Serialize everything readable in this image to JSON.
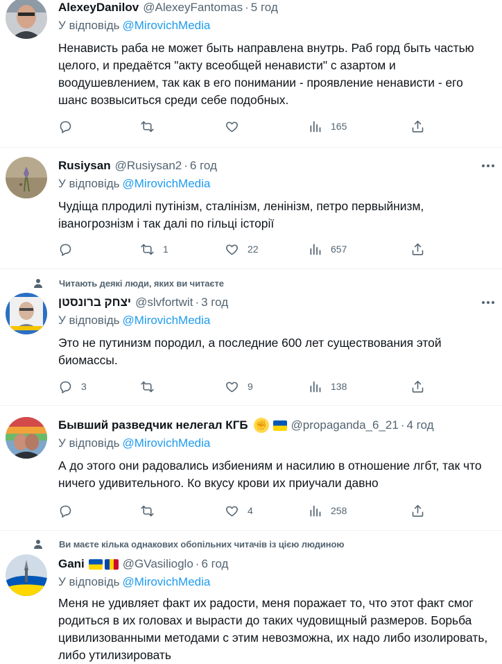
{
  "tweets": [
    {
      "name": "AlexeyDanilov",
      "handle": "@AlexeyFantomas",
      "dot": "·",
      "time": "5 год",
      "reply_prefix": "У відповідь",
      "reply_to": "@MirovichMedia",
      "text": "Ненависть раба не может быть направлена внутрь. Раб горд быть частью целого, и предаётся \"акту всеобщей ненависти\" с азартом и воодушевлением, так как в его понимании - проявление ненависти - его шанс возвыситься среди себе подобных.",
      "replies": "",
      "retweets": "",
      "likes": "",
      "views": "165"
    },
    {
      "name": "Rusiysan",
      "handle": "@Rusiysan2",
      "dot": "·",
      "time": "6 год",
      "reply_prefix": "У відповідь",
      "reply_to": "@MirovichMedia",
      "text": "Чудіща плродилі путінізм, сталінізм, ленінізм, петро первыйнизм, іваногрознізм і так далі по гільці історії",
      "replies": "",
      "retweets": "1",
      "likes": "22",
      "views": "657"
    },
    {
      "social_context": "Читають деякі люди, яких ви читаєте",
      "name": "יצחק ברונסטן",
      "handle": "@slvfortwit",
      "dot": "·",
      "time": "3 год",
      "reply_prefix": "У відповідь",
      "reply_to": "@MirovichMedia",
      "text": "Это не путинизм породил, а последние 600 лет существования этой биомассы.",
      "replies": "3",
      "retweets": "",
      "likes": "9",
      "views": "138"
    },
    {
      "name": "Бывший разведчик нелегал КГБ",
      "handle": "@propaganda_6_21",
      "dot": "·",
      "time": "4 год",
      "reply_prefix": "У відповідь",
      "reply_to": "@MirovichMedia",
      "text": "А до этого они радовались избиениям и насилию в отношение лгбт, так что ничего удивительного. Ко вкусу крови их приучали давно",
      "replies": "",
      "retweets": "",
      "likes": "4",
      "views": "258"
    },
    {
      "social_context": "Ви маєте кілька однакових обопільних читачів із цією людиною",
      "name": "Gani",
      "handle": "@GVasilioglo",
      "dot": "·",
      "time": "6 год",
      "reply_prefix": "У відповідь",
      "reply_to": "@MirovichMedia",
      "text": "Меня не удивляет факт их радости, меня поражает то, что этот факт смог родиться в их головах и вырасти до таких чудовищный размеров. Борьба цивилизованными методами с этим невозможна, их надо либо изолировать, либо утилизировать"
    }
  ],
  "icons": {
    "reply": "reply-icon",
    "retweet": "retweet-icon",
    "like": "heart-icon",
    "views": "views-icon",
    "share": "share-icon",
    "more": "more-icon",
    "social": "person-icon"
  },
  "colors": {
    "link": "#1d9bf0",
    "secondary_text": "#536471",
    "primary_text": "#0f1419",
    "divider": "#eff3f4"
  }
}
